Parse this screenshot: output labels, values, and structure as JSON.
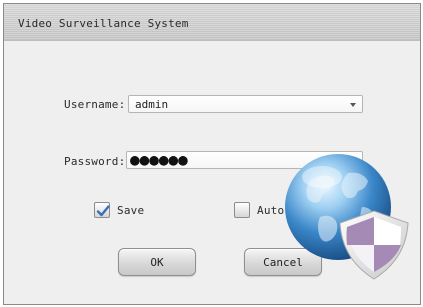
{
  "window": {
    "title": "Video Surveillance System"
  },
  "login": {
    "username_label": "Username:",
    "username_value": "admin",
    "password_label": "Password:",
    "password_mask": "●●●●●●",
    "save_label": "Save",
    "save_checked": true,
    "auto_label": "Auto",
    "auto_checked": false
  },
  "buttons": {
    "ok": "OK",
    "cancel": "Cancel"
  },
  "icons": {
    "logo": "globe-shield-icon",
    "dropdown": "chevron-down-icon",
    "check": "checkmark-icon"
  },
  "colors": {
    "window_bg": "#efefef",
    "titlebar": "#cfcfcf",
    "checkmark": "#3a6fb8",
    "globe_blue": "#3a86c8",
    "shield_purple": "#a58ab6"
  }
}
